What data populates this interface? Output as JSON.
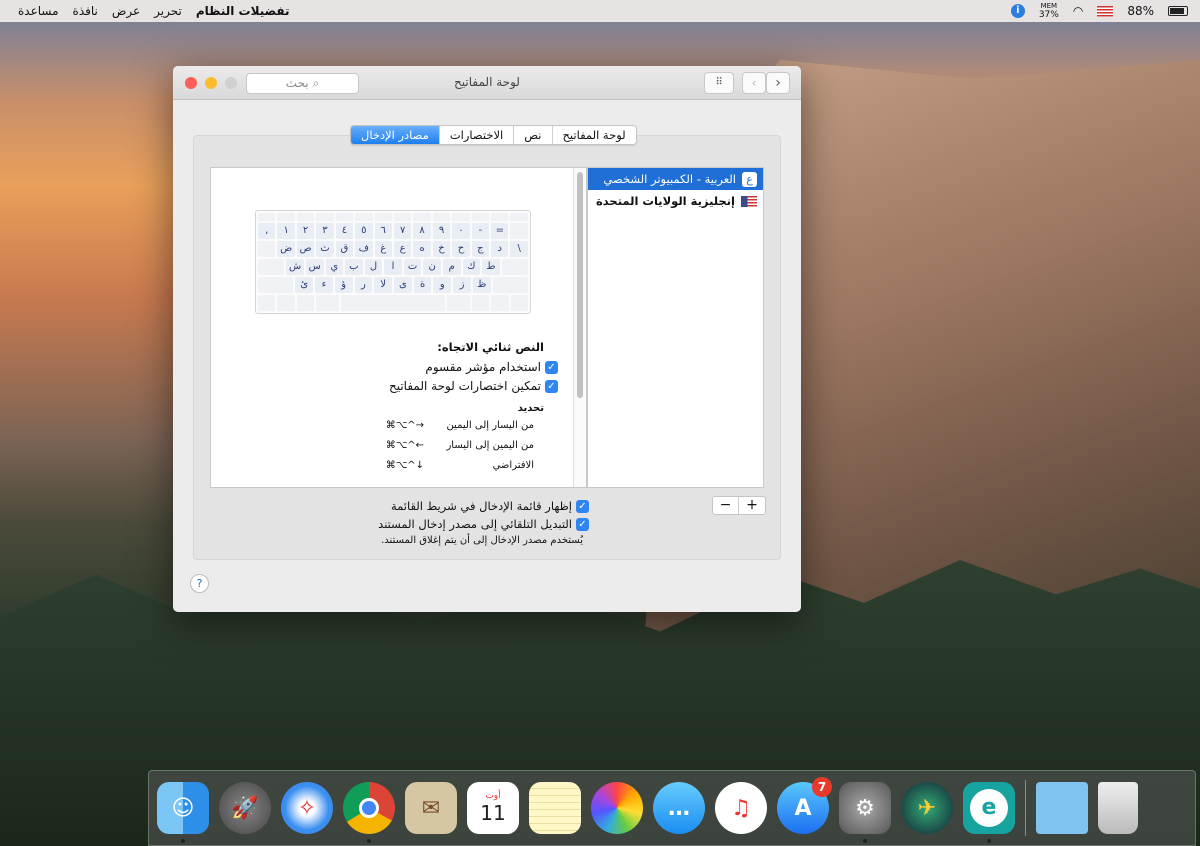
{
  "menubar": {
    "app": "تفضيلات النظام",
    "items": [
      "تحرير",
      "عرض",
      "نافذة",
      "مساعدة"
    ],
    "mem_label": "MEM",
    "mem_value": "37%",
    "battery": "88%"
  },
  "window": {
    "title": "لوحة المفاتيح",
    "search_placeholder": "بحث",
    "tabs": [
      "لوحة المفاتيح",
      "نص",
      "الاختصارات",
      "مصادر الإدخال"
    ],
    "active_tab": 3,
    "keyboard_rows": [
      [
        ",",
        "١",
        "٢",
        "٣",
        "٤",
        "٥",
        "٦",
        "٧",
        "٨",
        "٩",
        "٠",
        "-",
        "="
      ],
      [
        "ض",
        "ص",
        "ث",
        "ق",
        "ف",
        "غ",
        "ع",
        "ه",
        "خ",
        "ح",
        "ج",
        "د",
        "\\"
      ],
      [
        "ش",
        "س",
        "ي",
        "ب",
        "ل",
        "ا",
        "ت",
        "ن",
        "م",
        "ك",
        "ط"
      ],
      [
        "ئ",
        "ء",
        "ؤ",
        "ر",
        "لا",
        "ى",
        "ة",
        "و",
        "ز",
        "ظ"
      ]
    ],
    "bidi_title": "النص ثنائي الاتجاه:",
    "bidi_options": [
      {
        "label": "استخدام مؤشر مقسوم",
        "checked": true
      },
      {
        "label": "تمكين اختصارات لوحة المفاتيح",
        "checked": true
      }
    ],
    "selection_title": "تحديد",
    "shortcuts": [
      {
        "label": "من اليسار إلى اليمين",
        "keys": "⌘⌥^→"
      },
      {
        "label": "من اليمين إلى اليسار",
        "keys": "⌘⌥^←"
      },
      {
        "label": "الافتراضي",
        "keys": "⌘⌥^↓"
      }
    ],
    "sources": [
      {
        "label": "العربية - الكمبيوتر الشخصي",
        "icon": "ع",
        "selected": true
      },
      {
        "label": "إنجليزية الولايات المتحدة",
        "icon": "us-flag",
        "selected": false
      }
    ],
    "show_menu": {
      "label": "إظهار قائمة الإدخال في شريط القائمة",
      "checked": true
    },
    "auto_switch": {
      "label": "التبديل التلقائي إلى مصدر إدخال المستند",
      "checked": true
    },
    "note": "يُستخدم مصدر الإدخال إلى أن يتم إغلاق المستند.",
    "help": "?"
  },
  "dock": {
    "calendar_month": "أوت",
    "calendar_day": "11",
    "appstore_badge": "7"
  }
}
